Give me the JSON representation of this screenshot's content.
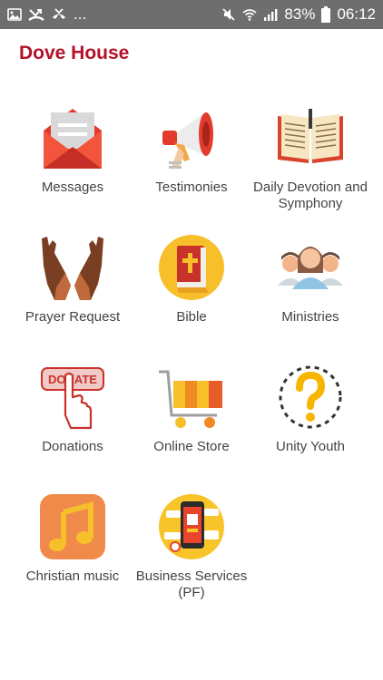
{
  "status_bar": {
    "left_icons": [
      "image-icon",
      "missed-call-icon",
      "call-end-icon"
    ],
    "overflow": "...",
    "right_icons": [
      "mute-icon",
      "wifi-icon",
      "signal-icon"
    ],
    "battery": "83%",
    "time": "06:12"
  },
  "app": {
    "title": "Dove House"
  },
  "tiles": [
    {
      "label": "Messages",
      "icon": "envelope-icon"
    },
    {
      "label": "Testimonies",
      "icon": "megaphone-icon"
    },
    {
      "label": "Daily Devotion and Symphony",
      "icon": "open-book-icon"
    },
    {
      "label": "Prayer Request",
      "icon": "praying-hands-icon"
    },
    {
      "label": "Bible",
      "icon": "bible-icon"
    },
    {
      "label": "Ministries",
      "icon": "people-group-icon"
    },
    {
      "label": "Donations",
      "icon": "donate-icon"
    },
    {
      "label": "Online Store",
      "icon": "shopping-cart-icon"
    },
    {
      "label": "Unity Youth",
      "icon": "question-mark-icon"
    },
    {
      "label": "Christian music",
      "icon": "music-note-icon"
    },
    {
      "label": "Business Services (PF)",
      "icon": "smartphone-business-icon"
    }
  ],
  "colors": {
    "title": "#b5112a",
    "status_bar": "#6e6e6e",
    "label": "#444444"
  },
  "icon_text": {
    "donate": "DONATE"
  }
}
